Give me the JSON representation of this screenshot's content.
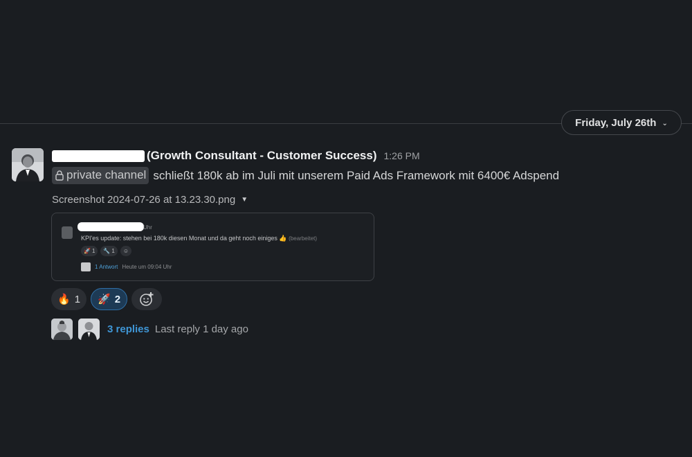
{
  "date_divider": {
    "label": "Friday, July 26th",
    "chevron_icon": "chevron-down-icon"
  },
  "message": {
    "sender_suffix": "(Growth Consultant - Customer Success)",
    "sender_redacted": true,
    "time": "1:26 PM",
    "channel_icon": "lock-icon",
    "channel_label": "private channel",
    "text": "schließt 180k ab im Juli mit unserem Paid Ads Framework mit 6400€ Adspend"
  },
  "attachment": {
    "file_name": "Screenshot 2024-07-26 at 13.23.30.png",
    "caret_icon": "caret-down-icon",
    "preview": {
      "header_time_fragment": "Uhr",
      "text": "KPI'es update: stehen bei 180k diesen Monat und da geht noch einiges 👍",
      "edited": "(bearbeitet)",
      "reactions": [
        {
          "emoji": "🚀",
          "count": "1"
        },
        {
          "emoji": "🔧",
          "count": "1"
        },
        {
          "emoji": "☺",
          "count": ""
        }
      ],
      "thread_link": "1 Antwort",
      "thread_time": "Heute um 09:04 Uhr"
    }
  },
  "reactions": [
    {
      "emoji": "🔥",
      "name": "fire-icon",
      "count": "1",
      "active": false
    },
    {
      "emoji": "🚀",
      "name": "rocket-icon",
      "count": "2",
      "active": true
    }
  ],
  "add_reaction_icon": "add-reaction-icon",
  "thread": {
    "replies_label": "3 replies",
    "last_reply": "Last reply 1 day ago"
  },
  "colors": {
    "background": "#1a1d21",
    "link": "#3f96d6",
    "active_reaction_bg": "#1d3a55",
    "active_reaction_border": "#2f6fa6"
  }
}
